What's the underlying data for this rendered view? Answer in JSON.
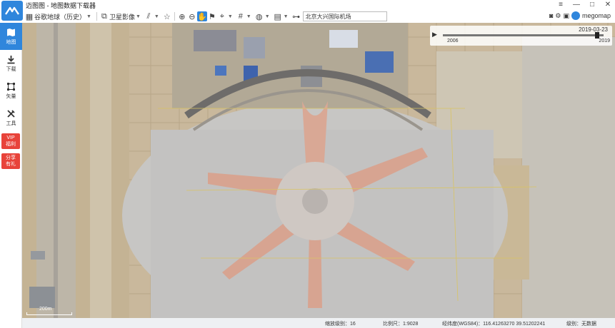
{
  "app": {
    "title": "迈图图 - 地图数据下载器",
    "brand_name": "megomap"
  },
  "window_controls": [
    "≡",
    "—",
    "□",
    "✕"
  ],
  "toolbar": {
    "map_source_label": "谷歌地球（历史）",
    "layer_label": "卫星影像",
    "search_value": "北京大兴国际机场"
  },
  "sidebar": {
    "items": [
      {
        "label": "地图",
        "icon": "map-icon"
      },
      {
        "label": "下载",
        "icon": "download-icon"
      },
      {
        "label": "矢量",
        "icon": "vector-icon"
      },
      {
        "label": "工具",
        "icon": "tools-icon"
      }
    ],
    "vip_label": "VIP\n福利",
    "share_label": "分享\n有礼"
  },
  "timeline": {
    "current_date": "2019-03-23",
    "start_year": "2006",
    "end_year": "2019",
    "position": 0.96
  },
  "scale": {
    "label": "200m"
  },
  "status": {
    "zoom_label": "缩放级别：16",
    "scale_label": "比例尺：1:9028",
    "coords_label": "经纬度(WGS84)：116.41263270 39.51202241",
    "level_label": "级别：无数据"
  },
  "colors": {
    "accent": "#2f86dc",
    "vip": "#e8433a"
  }
}
